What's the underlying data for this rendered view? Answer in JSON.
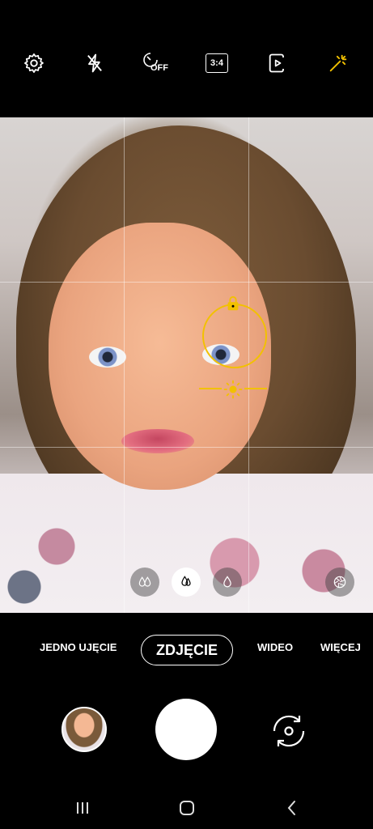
{
  "toolbar": {
    "icons": [
      "settings-icon",
      "flash-off-icon",
      "timer-off-icon",
      "aspect-ratio-icon",
      "motion-photo-icon",
      "filters-icon"
    ],
    "timer_label": "OFF",
    "ratio_label": "3:4"
  },
  "viewfinder": {
    "accent_color": "#f2c100",
    "filter_icons": [
      "effect-multi-icon",
      "effect-selected-icon",
      "effect-single-icon",
      "aperture-icon"
    ]
  },
  "modes": {
    "single_take": "JEDNO UJĘCIE",
    "photo": "ZDJĘCIE",
    "video": "WIDEO",
    "more": "WIĘCEJ"
  },
  "navbar": {
    "icons": [
      "recent-apps-icon",
      "home-icon",
      "back-icon"
    ]
  }
}
